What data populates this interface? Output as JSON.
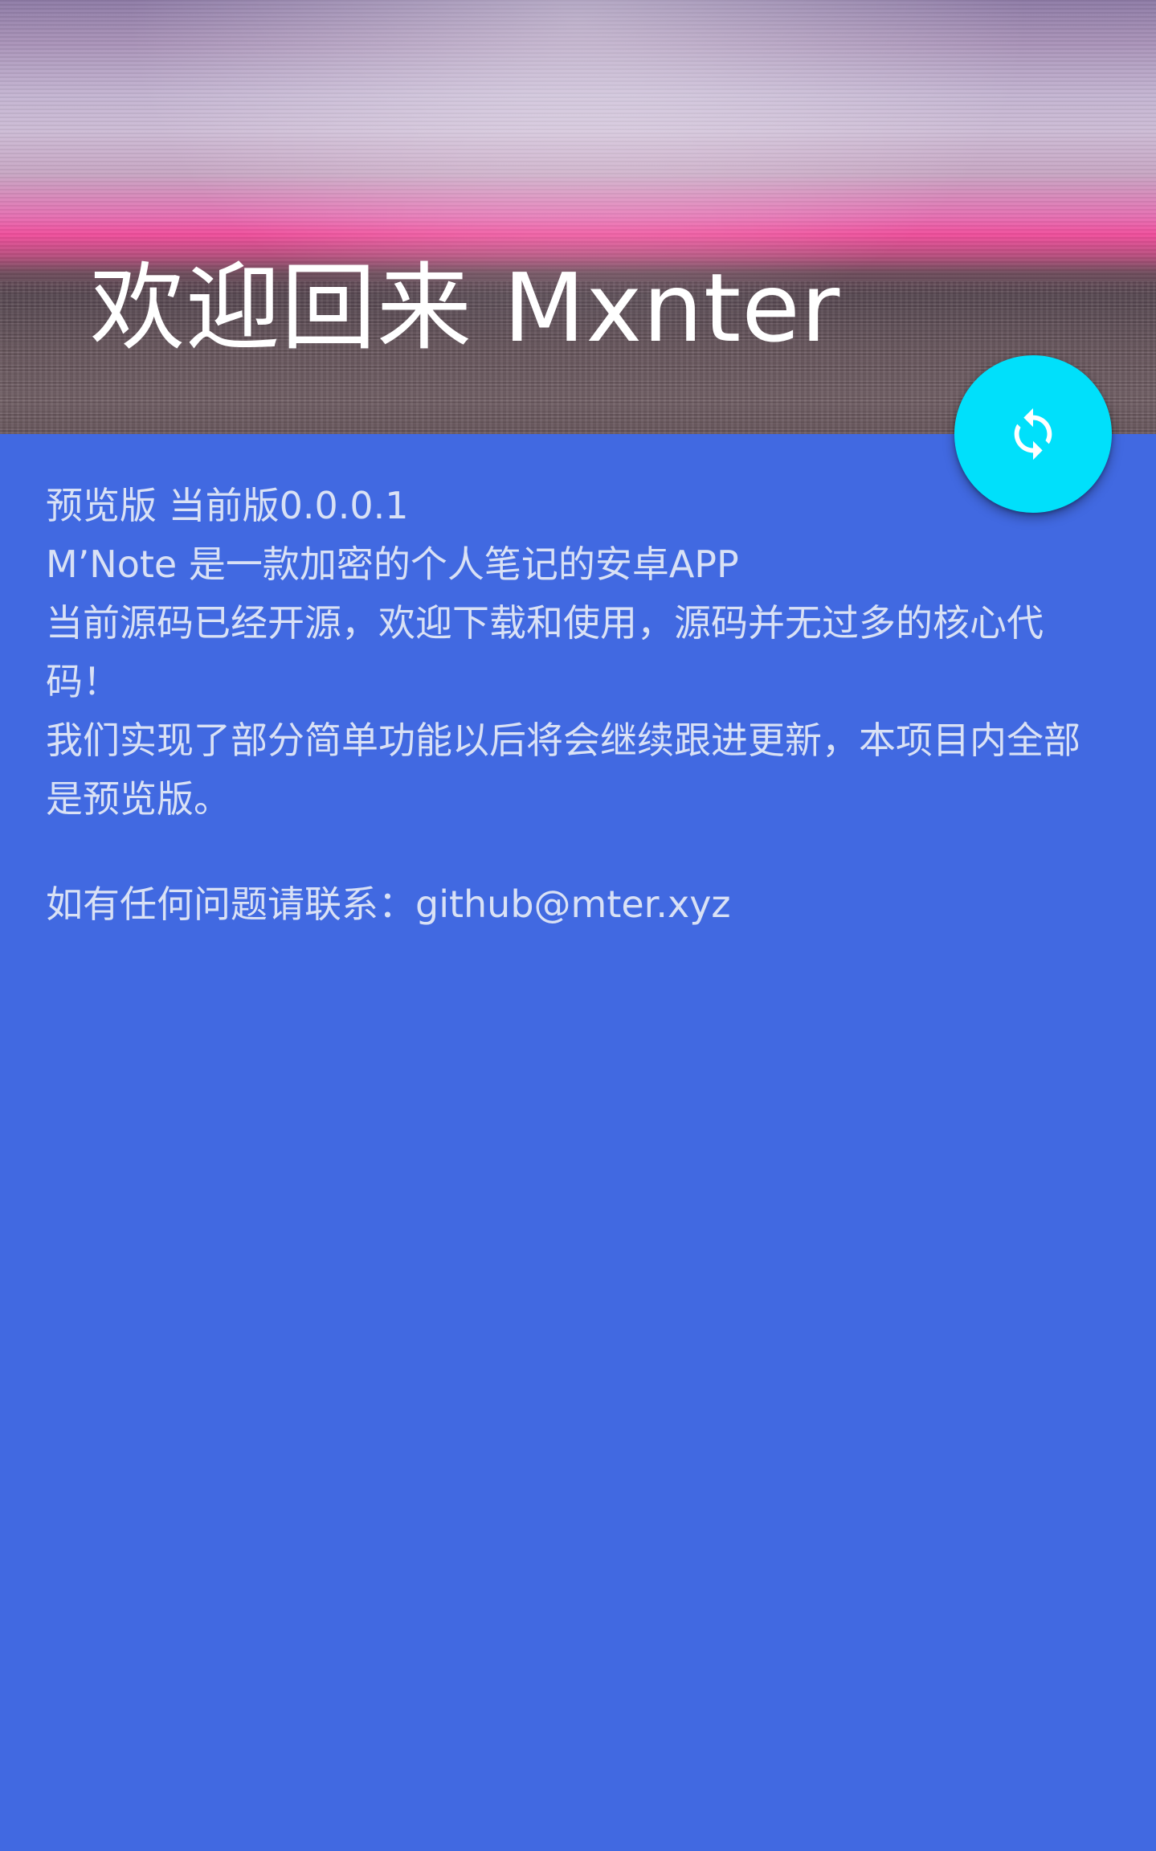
{
  "header": {
    "welcome_text": "欢迎回来 Mxnter"
  },
  "fab": {
    "icon": "refresh-icon",
    "color": "#00e0fb"
  },
  "content": {
    "version_line": "预览版 当前版0.0.0.1",
    "description_line": "M’Note 是一款加密的个人笔记的安卓APP",
    "open_source_line": "当前源码已经开源，欢迎下载和使用，源码并无过多的核心代码！",
    "features_line": "我们实现了部分简单功能以后将会继续跟进更新，本项目内全部是预览版。",
    "contact_line": "如有任何问题请联系：github@mter.xyz"
  },
  "colors": {
    "background": "#4169e1",
    "text": "#d9e1f5",
    "title_text": "#ffffff"
  }
}
